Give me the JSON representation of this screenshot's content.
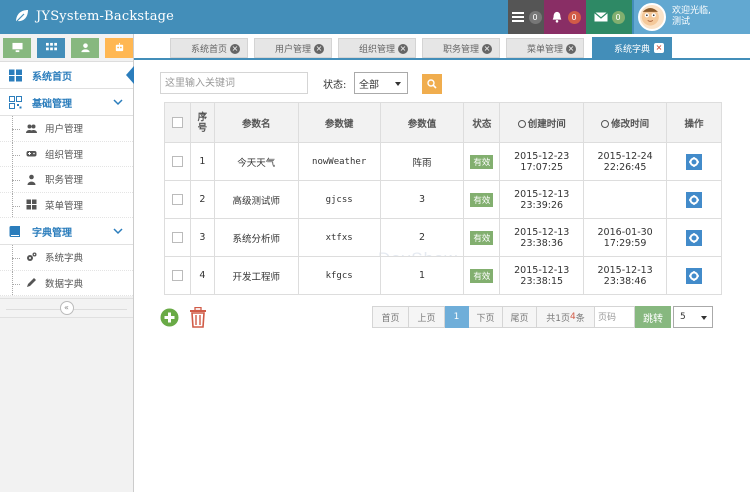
{
  "header": {
    "title": "JYSystem-Backstage",
    "buttons": [
      {
        "name": "tasks",
        "count": "0",
        "bg": "#555555",
        "badge": "#777777"
      },
      {
        "name": "notifications",
        "count": "0",
        "bg": "#892e65",
        "badge": "#d15b47"
      },
      {
        "name": "messages",
        "count": "0",
        "bg": "#2e8965",
        "badge": "#82af6f"
      }
    ],
    "user": {
      "greeting": "欢迎光临,",
      "name": "测试"
    }
  },
  "sidebar": {
    "shortcut_colors": [
      "#87b87f",
      "#438eb9",
      "#87b87f",
      "#ffb752"
    ],
    "items": [
      {
        "label": "系统首页"
      },
      {
        "label": "基础管理",
        "children": [
          "用户管理",
          "组织管理",
          "职务管理",
          "菜单管理"
        ]
      },
      {
        "label": "字典管理",
        "children": [
          "系统字典",
          "数据字典"
        ]
      }
    ]
  },
  "tabs": [
    "系统首页",
    "用户管理",
    "组织管理",
    "职务管理",
    "菜单管理",
    "系统字典"
  ],
  "toolbar": {
    "search_placeholder": "这里输入关键词",
    "status_label": "状态:",
    "status_value": "全部"
  },
  "table": {
    "headers": {
      "index": "序号",
      "name": "参数名",
      "key": "参数键",
      "value": "参数值",
      "status": "状态",
      "created": "创建时间",
      "modified": "修改时间",
      "ops": "操作"
    },
    "rows": [
      {
        "index": "1",
        "name": "今天天气",
        "key": "nowWeather",
        "value": "阵雨",
        "status": "有效",
        "created_date": "2015-12-23",
        "created_time": "17:07:25",
        "modified_date": "2015-12-24",
        "modified_time": "22:26:45"
      },
      {
        "index": "2",
        "name": "高级测试师",
        "key": "gjcss",
        "value": "3",
        "status": "有效",
        "created_date": "2015-12-13",
        "created_time": "23:39:26",
        "modified_date": "",
        "modified_time": ""
      },
      {
        "index": "3",
        "name": "系统分析师",
        "key": "xtfxs",
        "value": "2",
        "status": "有效",
        "created_date": "2015-12-13",
        "created_time": "23:38:36",
        "modified_date": "2016-01-30",
        "modified_time": "17:29:59"
      },
      {
        "index": "4",
        "name": "开发工程师",
        "key": "kfgcs",
        "value": "1",
        "status": "有效",
        "created_date": "2015-12-13",
        "created_time": "23:38:15",
        "modified_date": "2015-12-13",
        "modified_time": "23:38:46"
      }
    ]
  },
  "pager": {
    "first": "首页",
    "prev": "上页",
    "current": "1",
    "next": "下页",
    "last": "尾页",
    "total_prefix": "共1页",
    "total_count": "4",
    "total_suffix": "条",
    "page_placeholder": "页码",
    "go": "跳转",
    "page_size": "5"
  },
  "watermark": "DayShow"
}
